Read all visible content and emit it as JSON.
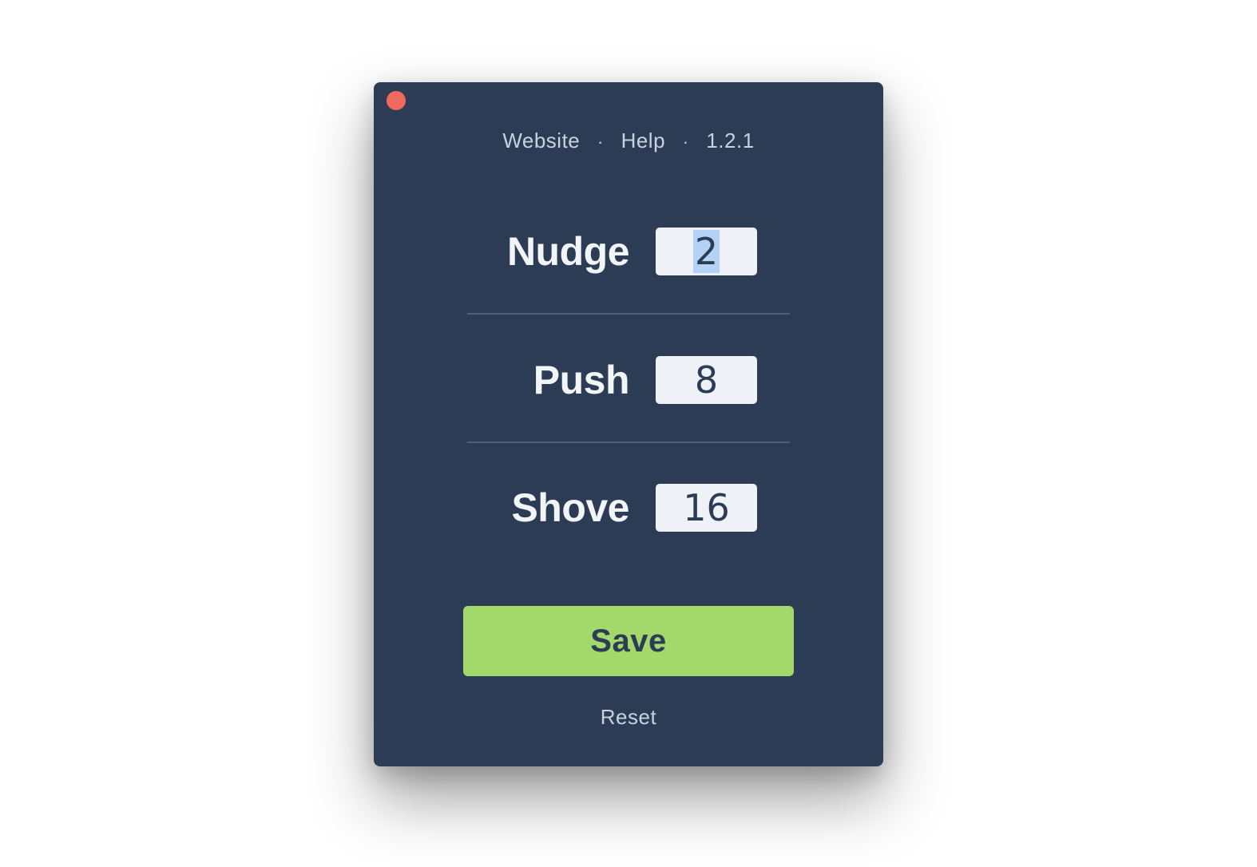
{
  "window": {
    "close_color": "#ee6a5f",
    "background": "#2c3c55"
  },
  "nav": {
    "website": "Website",
    "separator": "·",
    "help": "Help",
    "version": "1.2.1"
  },
  "settings": {
    "nudge": {
      "label": "Nudge",
      "value": "2"
    },
    "push": {
      "label": "Push",
      "value": "8"
    },
    "shove": {
      "label": "Shove",
      "value": "16"
    }
  },
  "actions": {
    "save_label": "Save",
    "save_color": "#a3d96b",
    "reset_label": "Reset"
  }
}
